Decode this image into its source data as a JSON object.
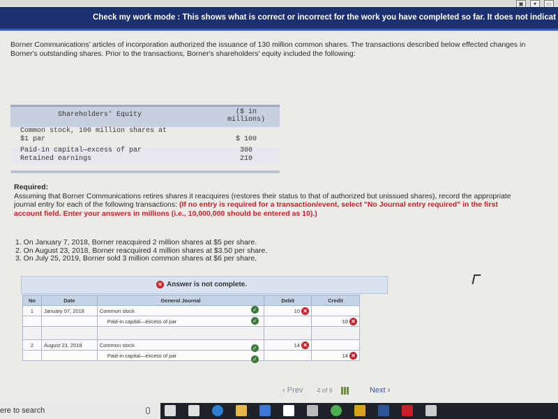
{
  "banner": {
    "text": "Check my work mode : This shows what is correct or incorrect for the work you have completed so far. It does not indicat"
  },
  "intro": "Borner Communications' articles of incorporation authorized the issuance of 130 million common shares. The transactions described below effected changes in Borner's outstanding shares. Prior to the transactions, Borner's shareholders' equity included the following:",
  "equity": {
    "header_label": "Shareholders' Equity",
    "header_value_line1": "($ in",
    "header_value_line2": "millions)",
    "rows": [
      {
        "label": "Common stock, 100 million shares at",
        "value": ""
      },
      {
        "label": "$1 par",
        "value": "$ 100"
      },
      {
        "label": "Paid-in capital—excess of par",
        "value": "300"
      },
      {
        "label": "Retained earnings",
        "value": "210"
      }
    ]
  },
  "required": {
    "heading": "Required:",
    "text": "Assuming that Borner Communications retires shares it reacquires (restores their status to that of authorized but unissued shares), record the appropriate journal entry for each of the following transactions:",
    "red_note": "(If no entry is required for a transaction/event, select \"No Journal entry required\" in the first account field. Enter your answers in millions (i.e., 10,000,000 should be entered as 10).)"
  },
  "transactions": [
    "1. On January 7, 2018, Borner reacquired 2 million shares at $5 per share.",
    "2. On August 23, 2018, Borner reacquired 4 million shares at $3.50 per share.",
    "3. On July 25, 2019, Borner sold 3 million common shares at $6 per share."
  ],
  "answer_status": "Answer is not complete.",
  "journal": {
    "headers": {
      "no": "No",
      "date": "Date",
      "general_journal": "General Journal",
      "debit": "Debit",
      "credit": "Credit"
    },
    "entries": [
      {
        "no": "1",
        "date": "January 07, 2018",
        "account": "Common stock",
        "debit": "10",
        "credit": ""
      },
      {
        "no": "",
        "date": "",
        "account": "Paid-in capital—excess of par",
        "debit": "",
        "credit": "10"
      },
      {
        "no": "2",
        "date": "August 23, 2018",
        "account": "Common stock",
        "debit": "14",
        "credit": ""
      },
      {
        "no": "",
        "date": "",
        "account": "Paid-in capital—excess of par",
        "debit": "",
        "credit": "14"
      }
    ]
  },
  "pager": {
    "prev": "Prev",
    "page_current": "4",
    "page_of": "of",
    "page_total": "6",
    "next": "Next"
  },
  "taskbar": {
    "search": "ere to search"
  }
}
